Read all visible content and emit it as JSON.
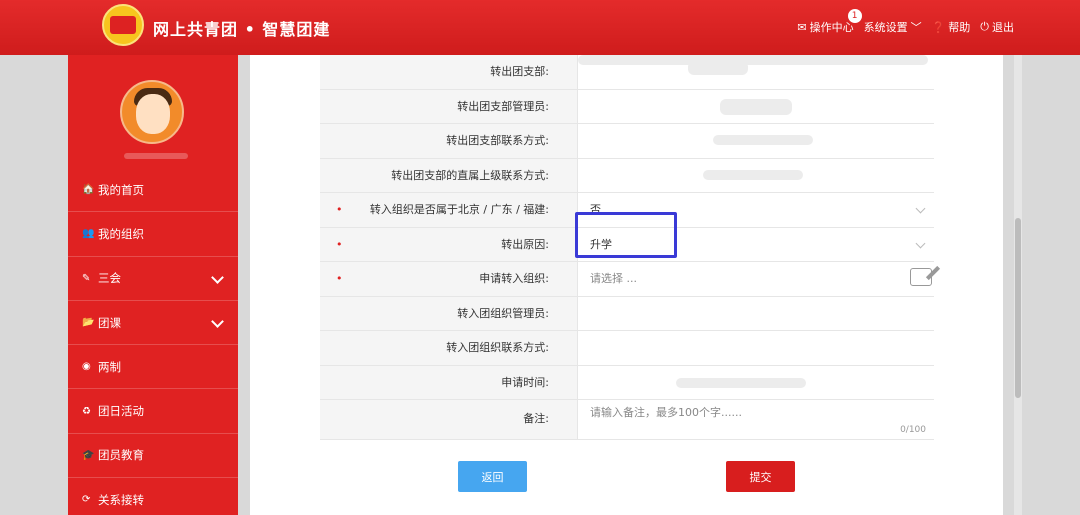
{
  "header": {
    "brand": "网上共青团 • 智慧团建",
    "items": [
      {
        "label": "操作中心",
        "icon": "mail-icon",
        "badge": "1"
      },
      {
        "label": "系统设置",
        "icon": "chevron-down-icon"
      },
      {
        "label": "帮助",
        "icon": "help-icon"
      },
      {
        "label": "退出",
        "icon": "power-icon"
      }
    ]
  },
  "sidebar": {
    "items": [
      {
        "label": "我的首页",
        "icon": "home-icon",
        "glyph": "🏠"
      },
      {
        "label": "我的组织",
        "icon": "users-icon",
        "glyph": "👥"
      },
      {
        "label": "三会",
        "icon": "edit-icon",
        "glyph": "✎"
      },
      {
        "label": "团课",
        "icon": "folder-icon",
        "glyph": "📂"
      },
      {
        "label": "两制",
        "icon": "circle-icon",
        "glyph": "◉"
      },
      {
        "label": "团日活动",
        "icon": "recycle-icon",
        "glyph": "♻"
      },
      {
        "label": "团员教育",
        "icon": "graduation-cap-icon",
        "glyph": "🎓"
      },
      {
        "label": "关系接转",
        "icon": "refresh-icon",
        "glyph": "⟳"
      }
    ]
  },
  "form": {
    "rows": [
      {
        "label": "转出团支部:",
        "required": false,
        "value": ""
      },
      {
        "label": "转出团支部管理员:",
        "required": false,
        "value": ""
      },
      {
        "label": "转出团支部联系方式:",
        "required": false,
        "value": ""
      },
      {
        "label": "转出团支部的直属上级联系方式:",
        "required": false,
        "value": ""
      },
      {
        "label": "转入组织是否属于北京 / 广东 / 福建:",
        "required": true,
        "value": "否"
      },
      {
        "label": "转出原因:",
        "required": true,
        "value": "升学"
      },
      {
        "label": "申请转入组织:",
        "required": true,
        "placeholder": "请选择 ..."
      },
      {
        "label": "转入团组织管理员:",
        "required": false,
        "value": ""
      },
      {
        "label": "转入团组织联系方式:",
        "required": false,
        "value": ""
      },
      {
        "label": "申请时间:",
        "required": false,
        "value": ""
      }
    ],
    "remark": {
      "label": "备注:",
      "placeholder": "请输入备注，最多100个字......",
      "counter": "0/100"
    },
    "required_mark": "•"
  },
  "buttons": {
    "back": "返回",
    "submit": "提交"
  },
  "colors": {
    "brand_red": "#e02222",
    "back_blue": "#46a6f0",
    "highlight": "#3a3ad6"
  }
}
